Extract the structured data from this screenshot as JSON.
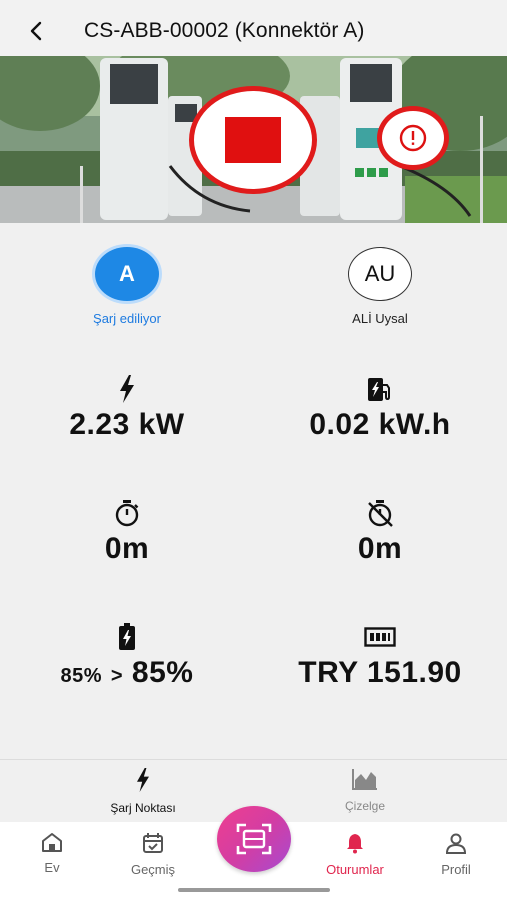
{
  "header": {
    "title": "CS-ABB-00002 (Konnektör A)"
  },
  "connector": {
    "letter": "A",
    "status": "Şarj ediliyor"
  },
  "user": {
    "initials": "AU",
    "name": "ALİ Uysal"
  },
  "stats": {
    "power": "2.23 kW",
    "energy": "0.02 kW.h",
    "duration": "0m",
    "idle_duration": "0m",
    "soc_start": "85%",
    "soc_arrow": ">",
    "soc_current": "85%",
    "cost": "TRY 151.90"
  },
  "subtabs": {
    "charge_point": "Şarj Noktası",
    "chart": "Çizelge"
  },
  "bottom_nav": {
    "home": "Ev",
    "history": "Geçmiş",
    "sessions": "Oturumlar",
    "profile": "Profil"
  },
  "colors": {
    "accent_blue": "#1e88e5",
    "stop_red": "#e01010",
    "active_nav": "#e0264e"
  }
}
